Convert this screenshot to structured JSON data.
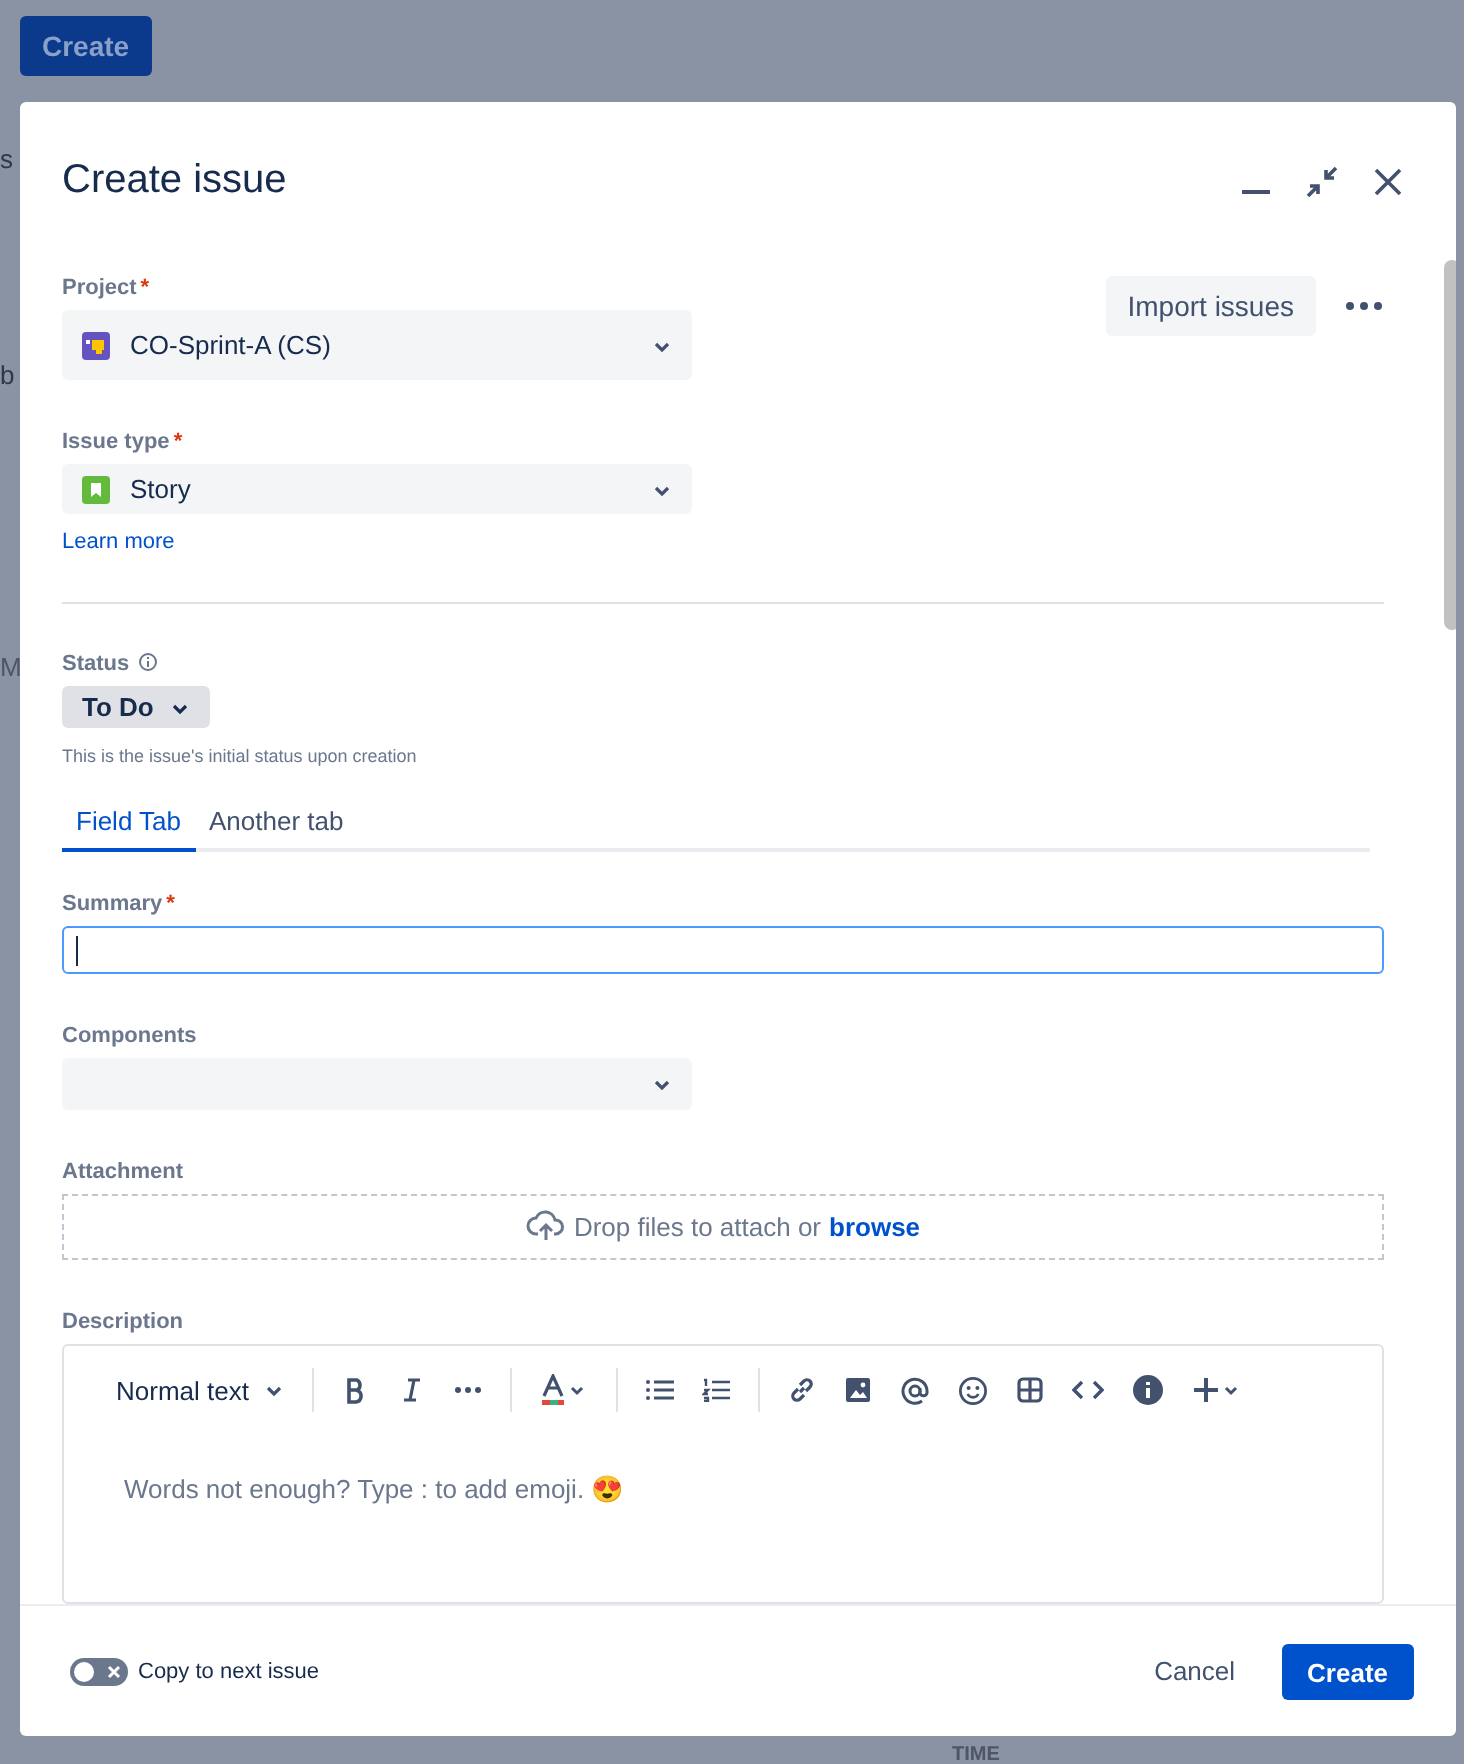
{
  "background": {
    "create_button": "Create",
    "fragments": [
      "s",
      "b",
      "M",
      "TIME"
    ]
  },
  "dialog": {
    "title": "Create issue",
    "import_button": "Import issues",
    "project": {
      "label": "Project",
      "required_mark": "*",
      "value": "CO-Sprint-A (CS)"
    },
    "issue_type": {
      "label": "Issue type",
      "required_mark": "*",
      "value": "Story",
      "link": "Learn more"
    },
    "status": {
      "label": "Status",
      "value": "To Do",
      "helper": "This is the issue's initial status upon creation"
    },
    "tabs": [
      {
        "label": "Field Tab",
        "selected": true
      },
      {
        "label": "Another tab",
        "selected": false
      }
    ],
    "summary": {
      "label": "Summary",
      "required_mark": "*",
      "focused": true
    },
    "components": {
      "label": "Components"
    },
    "attachment": {
      "label": "Attachment",
      "text": "Drop files to attach or",
      "link": "browse"
    },
    "description": {
      "label": "Description",
      "style": "Normal text",
      "placeholder": "Words not enough? Type : to add emoji. 😍"
    },
    "footer": {
      "copy_toggle": {
        "label": "Copy to next issue",
        "on": false
      },
      "cancel": "Cancel",
      "create": "Create"
    }
  }
}
